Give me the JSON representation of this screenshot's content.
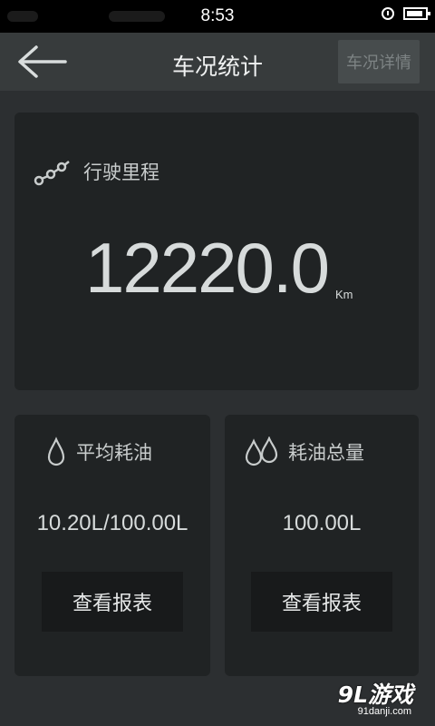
{
  "status_bar": {
    "time": "8:53"
  },
  "header": {
    "title": "车况统计",
    "details_button": "车况详情"
  },
  "mileage": {
    "label": "行驶里程",
    "value": "12220.0",
    "unit": "Km"
  },
  "avg_fuel": {
    "label": "平均耗油",
    "value": "10.20L/100.00L",
    "button": "查看报表"
  },
  "total_fuel": {
    "label": "耗油总量",
    "value": "100.00L",
    "button": "查看报表"
  },
  "watermark": {
    "main": "9L游戏",
    "sub": "91danji.com"
  },
  "icons": {
    "back": "back-arrow-icon",
    "route": "route-icon",
    "drop": "drop-icon",
    "drops": "double-drop-icon",
    "alarm": "alarm-clock-icon",
    "battery": "battery-icon"
  }
}
